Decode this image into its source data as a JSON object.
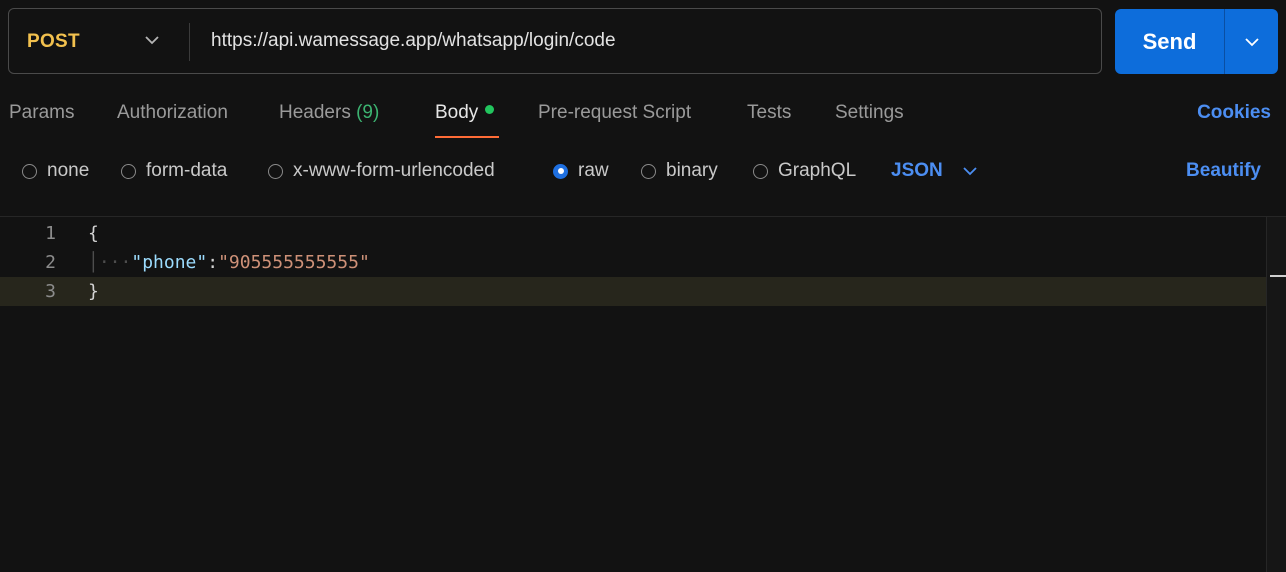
{
  "request": {
    "method": "POST",
    "url": "https://api.wamessage.app/whatsapp/login/code",
    "send_label": "Send"
  },
  "tabs": [
    {
      "label": "Params"
    },
    {
      "label": "Authorization"
    },
    {
      "label": "Headers",
      "count": "(9)"
    },
    {
      "label": "Body",
      "active": true
    },
    {
      "label": "Pre-request Script"
    },
    {
      "label": "Tests"
    },
    {
      "label": "Settings"
    }
  ],
  "cookies_label": "Cookies",
  "body_options": [
    {
      "label": "none",
      "checked": false
    },
    {
      "label": "form-data",
      "checked": false
    },
    {
      "label": "x-www-form-urlencoded",
      "checked": false
    },
    {
      "label": "raw",
      "checked": true
    },
    {
      "label": "binary",
      "checked": false
    },
    {
      "label": "GraphQL",
      "checked": false
    }
  ],
  "format_label": "JSON",
  "beautify_label": "Beautify",
  "editor": {
    "line_numbers": [
      "1",
      "2",
      "3"
    ],
    "open_brace": "{",
    "key": "\"phone\"",
    "colon": ":",
    "value": "\"905555555555\"",
    "close_brace": "}"
  },
  "colors": {
    "method": "#f2c14e",
    "accent": "#0d6ddb",
    "link": "#4c8ef2",
    "tab_indicator": "#ff6c37",
    "body_dot": "#22c55e"
  }
}
